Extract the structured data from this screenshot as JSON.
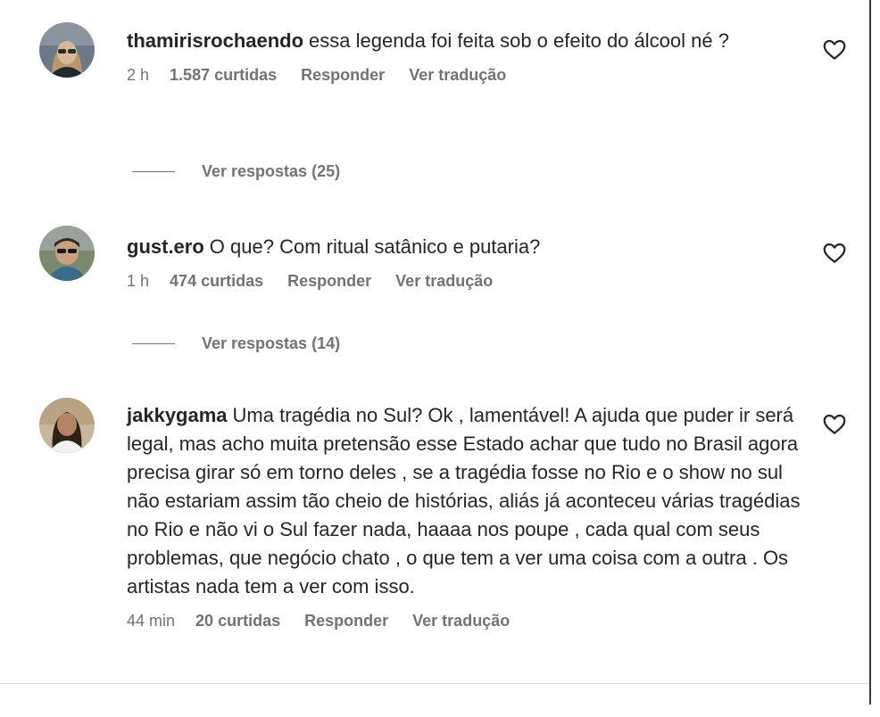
{
  "comments": [
    {
      "username": "thamirisrochaendo",
      "text": "essa legenda foi feita sob o efeito do álcool né ?",
      "time": "2 h",
      "likes": "1.587 curtidas",
      "reply_label": "Responder",
      "translate_label": "Ver tradução",
      "view_replies": "Ver respostas (25)"
    },
    {
      "username": "gust.ero",
      "text": "O que? Com ritual satânico e putaria?",
      "time": "1 h",
      "likes": "474 curtidas",
      "reply_label": "Responder",
      "translate_label": "Ver tradução",
      "view_replies": "Ver respostas (14)"
    },
    {
      "username": "jakkygama",
      "text": "Uma tragédia no Sul? Ok , lamentável! A ajuda que puder ir será legal, mas acho muita pretensão esse Estado achar que tudo no Brasil agora precisa girar só em torno deles , se a tragédia fosse no Rio e o show no sul não estariam assim tão cheio de histórias, aliás já aconteceu várias tragédias no Rio e não vi o Sul fazer nada, haaaa nos poupe , cada qual com seus problemas, que negócio chato , o que tem a ver uma coisa com a outra . Os artistas nada tem a ver com isso.",
      "time": "44 min",
      "likes": "20 curtidas",
      "reply_label": "Responder",
      "translate_label": "Ver tradução"
    }
  ],
  "icons": {
    "like": "heart-outline-icon"
  }
}
